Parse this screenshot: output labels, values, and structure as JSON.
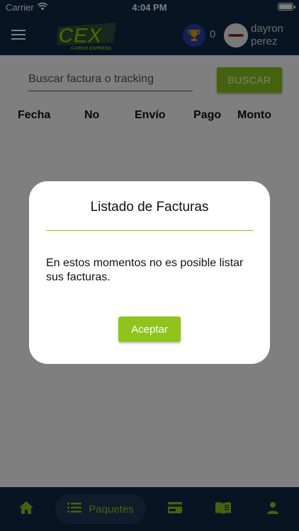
{
  "status_bar": {
    "carrier": "Carrier",
    "time": "4:04 PM"
  },
  "header": {
    "logo_text": "CEX",
    "logo_subtitle": "CARGO EXPRESS",
    "points": "0",
    "user_first_name": "dayron",
    "user_last_name": "perez"
  },
  "search": {
    "placeholder": "Buscar factura o tracking",
    "value": "",
    "button_label": "BUSCAR"
  },
  "table": {
    "columns": [
      "Fecha",
      "No",
      "Envío",
      "Pago",
      "Monto"
    ]
  },
  "dialog": {
    "title": "Listado de Facturas",
    "message": "En estos momentos no es posible listar sus facturas.",
    "accept_label": "Aceptar"
  },
  "bottom_nav": {
    "items": [
      {
        "icon": "home-icon",
        "label": ""
      },
      {
        "icon": "list-icon",
        "label": "Paquetes"
      },
      {
        "icon": "card-icon",
        "label": ""
      },
      {
        "icon": "book-icon",
        "label": ""
      },
      {
        "icon": "person-icon",
        "label": ""
      }
    ],
    "active_index": 1
  },
  "colors": {
    "primary": "#0e2a47",
    "accent": "#8fc41c",
    "trophy_bg": "#2940a8"
  }
}
